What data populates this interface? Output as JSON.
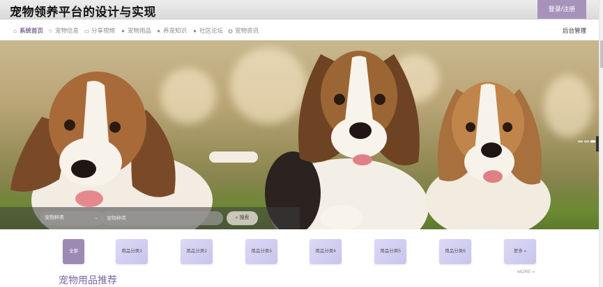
{
  "header": {
    "site_title": "宠物领养平台的设计与实现",
    "login_label": "登录/注册"
  },
  "nav": {
    "items": [
      {
        "icon": "home-icon",
        "label": "系统首页"
      },
      {
        "icon": "star-icon",
        "label": "宠物信息"
      },
      {
        "icon": "folder-icon",
        "label": "分享视频"
      },
      {
        "icon": "info-icon",
        "label": "宠物用品"
      },
      {
        "icon": "question-icon",
        "label": "养宠知识"
      },
      {
        "icon": "info-icon",
        "label": "社区论坛"
      },
      {
        "icon": "globe-icon",
        "label": "宠物资讯"
      }
    ],
    "admin_label": "后台管理"
  },
  "search": {
    "category_placeholder": "宠物种类",
    "input_placeholder": "宠物种类",
    "button_label": "搜索"
  },
  "categories": {
    "items": [
      "全部",
      "用品分类1",
      "用品分类2",
      "用品分类3",
      "用品分类4",
      "用品分类5",
      "用品分类6",
      "更多 »"
    ],
    "more_label": "MORE »"
  },
  "section": {
    "title": "宠物用品推荐"
  },
  "colors": {
    "accent": "#a793b9",
    "active_nav": "#7c6a98",
    "category_bg": "#cfcbf0",
    "section_title": "#7766a3"
  }
}
